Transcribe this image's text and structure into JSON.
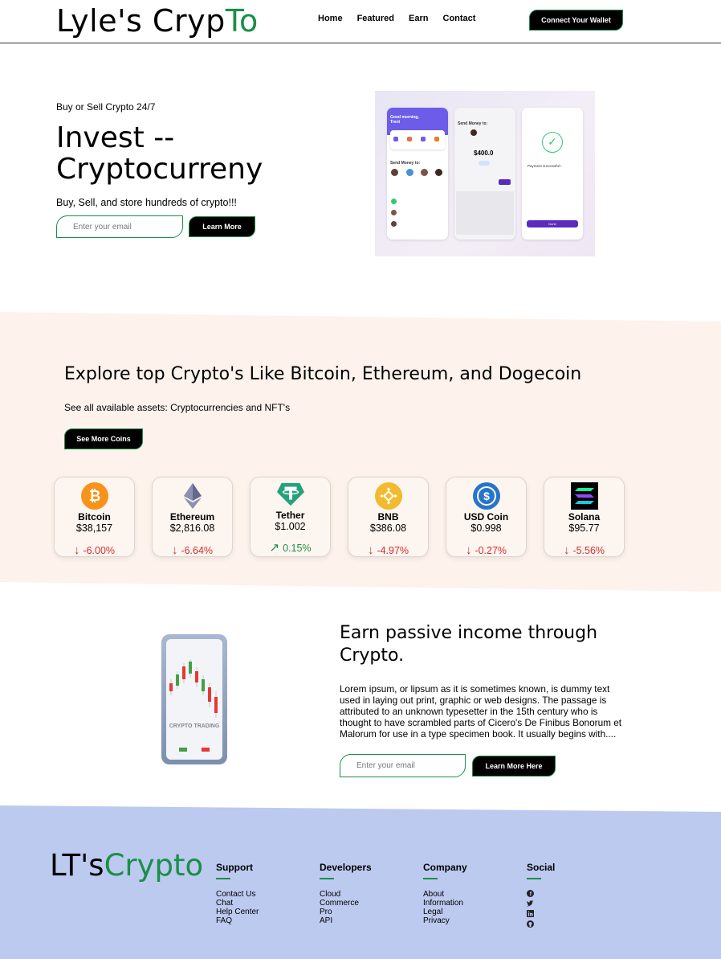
{
  "nav": {
    "logo_main": "Lyle's Cryp",
    "logo_accent": "To",
    "links": [
      "Home",
      "Featured",
      "Earn",
      "Contact"
    ],
    "connect_label": "Connect Your Wallet"
  },
  "hero": {
    "subtitle": "Buy or Sell Crypto 24/7",
    "title_line1": "Invest --",
    "title_line2": "Cryptocurreny",
    "description": "Buy, Sell, and store hundreds of crypto!!!",
    "email_placeholder": "Enter your email",
    "button_label": "Learn More",
    "mockup": {
      "greeting": "Good morning, Trent",
      "send_money": "Send Money to:",
      "amount": "$400.0",
      "payment_success": "Payment successful !",
      "done": "Done"
    }
  },
  "explore": {
    "title": "Explore top Crypto's Like Bitcoin, Ethereum, and Dogecoin",
    "subtitle": "See all available assets: Cryptocurrencies and NFT's",
    "button_label": "See More Coins",
    "coins": [
      {
        "name": "Bitcoin",
        "price": "$38,157",
        "change": "-6.00%",
        "direction": "down",
        "color": "#f7931a",
        "icon": "bitcoin-icon"
      },
      {
        "name": "Ethereum",
        "price": "$2,816.08",
        "change": "-6.64%",
        "direction": "down",
        "color": "#8c8c8c",
        "icon": "ethereum-icon"
      },
      {
        "name": "Tether",
        "price": "$1.002",
        "change": "0.15%",
        "direction": "up",
        "color": "#26a17b",
        "icon": "tether-icon"
      },
      {
        "name": "BNB",
        "price": "$386.08",
        "change": "-4.97%",
        "direction": "down",
        "color": "#f3ba2f",
        "icon": "bnb-icon"
      },
      {
        "name": "USD Coin",
        "price": "$0.998",
        "change": "-0.27%",
        "direction": "down",
        "color": "#2775ca",
        "icon": "usd-coin-icon"
      },
      {
        "name": "Solana",
        "price": "$95.77",
        "change": "-5.56%",
        "direction": "down",
        "color": "#000000",
        "icon": "solana-icon"
      }
    ]
  },
  "earn": {
    "title": "Earn passive income through Crypto.",
    "body": "Lorem ipsum, or lipsum as it is sometimes known, is dummy text used in laying out print, graphic or web designs. The passage is attributed to an unknown typesetter in the 15th century who is thought to have scrambled parts of Cicero's De Finibus Bonorum et Malorum for use in a type specimen book. It usually begins with....",
    "email_placeholder": "Enter your email",
    "button_label": "Learn More Here",
    "phone_caption": "CRYPTO TRADING"
  },
  "footer": {
    "logo_main": "LT's",
    "logo_accent": "Crypto",
    "columns": [
      {
        "heading": "Support",
        "items": [
          "Contact Us",
          "Chat",
          "Help Center",
          "FAQ"
        ]
      },
      {
        "heading": "Developers",
        "items": [
          "Cloud",
          "Commerce",
          "Pro",
          "API"
        ]
      },
      {
        "heading": "Company",
        "items": [
          "About",
          "Information",
          "Legal",
          "Privacy"
        ]
      }
    ],
    "social_heading": "Social",
    "social_icons": [
      "facebook-icon",
      "twitter-icon",
      "linkedin-icon",
      "github-icon"
    ]
  },
  "colors": {
    "accent": "#1a8f47",
    "explore_bg": "#fdf2ec",
    "footer_bg": "#bccaf0",
    "down": "#d32f2f"
  }
}
